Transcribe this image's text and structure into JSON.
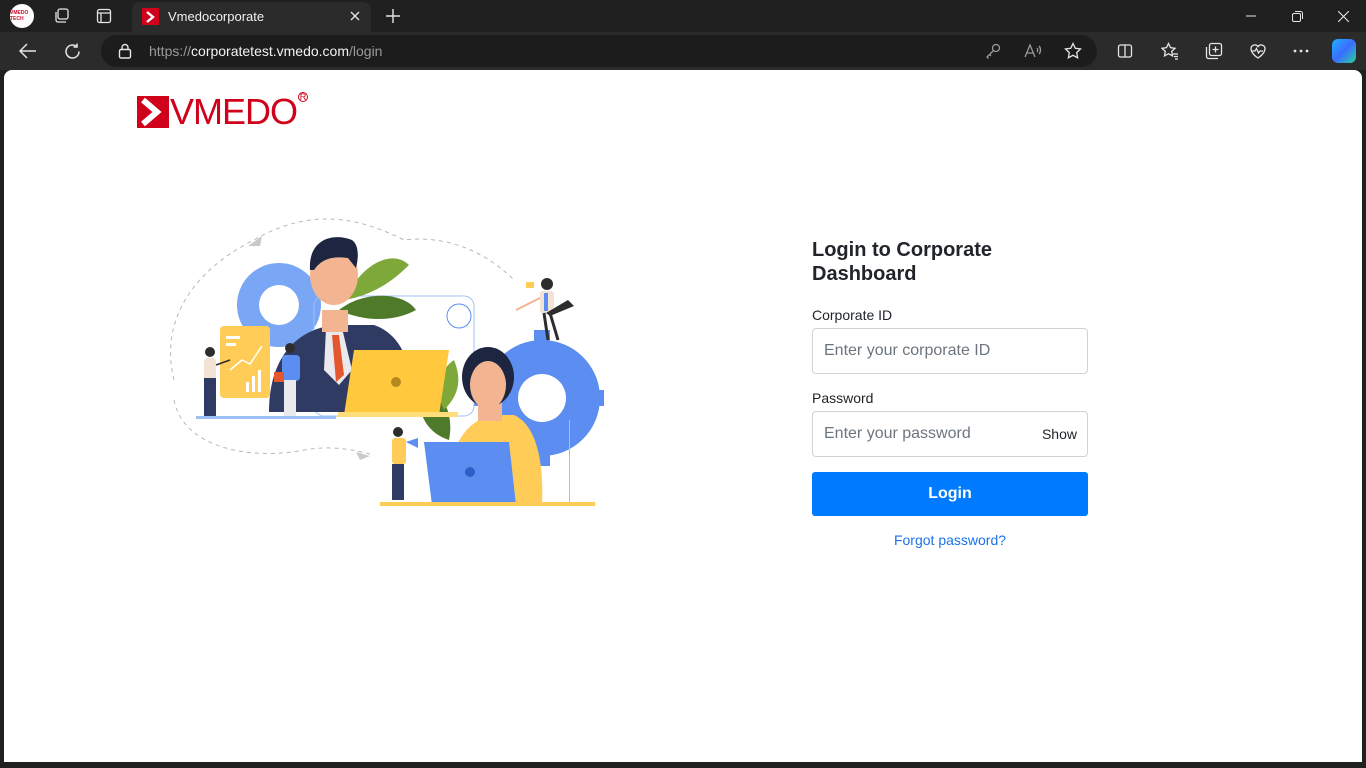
{
  "browser": {
    "profile_label": "VMEDO TECH",
    "tab": {
      "title": "Vmedocorporate"
    },
    "address": {
      "scheme": "https://",
      "host": "corporatetest.vmedo.com",
      "path": "/login"
    }
  },
  "page": {
    "logo_text": "VMEDO",
    "logo_reg": "R",
    "login": {
      "title": "Login to Corporate Dashboard",
      "corporate_id_label": "Corporate ID",
      "corporate_id_placeholder": "Enter your corporate ID",
      "password_label": "Password",
      "password_placeholder": "Enter your password",
      "show_label": "Show",
      "submit_label": "Login",
      "forgot_label": "Forgot password?"
    }
  },
  "colors": {
    "brand_red": "#d0021b",
    "primary_blue": "#007bff",
    "link_blue": "#1a73e8"
  }
}
